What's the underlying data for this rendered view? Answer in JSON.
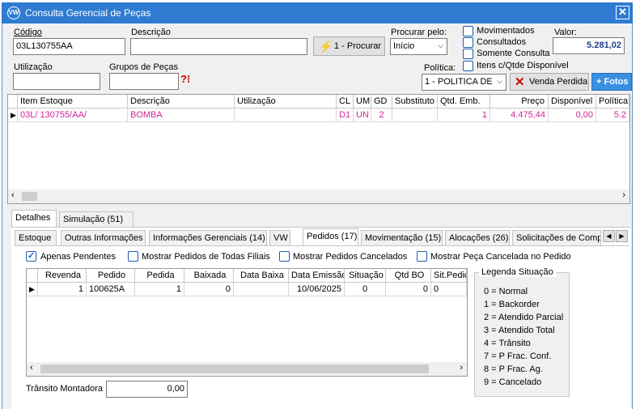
{
  "window": {
    "title": "Consulta Gerencial de Peças",
    "logo": "VW"
  },
  "form": {
    "codigo_label": "Código",
    "codigo_value": "03L130755AA",
    "descricao_label": "Descrição",
    "descricao_value": "",
    "procurar_button": "1 - Procurar",
    "procurar_pelo_label": "Procurar pelo:",
    "procurar_pelo_value": "Início",
    "utilizacao_label": "Utilização",
    "utilizacao_value": "",
    "grupos_label": "Grupos de Peças",
    "grupos_value": "",
    "filters": {
      "movimentados": "Movimentados",
      "consultados": "Consultados",
      "somente_consulta": "Somente Consulta",
      "itens_qtde": "Itens c/Qtde Disponível"
    },
    "valor_label": "Valor:",
    "valor_value": "5.281,02",
    "politica_label": "Política:",
    "politica_value": "1 - POLITICA DE",
    "venda_perdida_button": "Venda Perdida",
    "fotos_button": "+ Fotos"
  },
  "items_grid": {
    "columns": [
      "Item Estoque",
      "Descrição",
      "Utilização",
      "CL",
      "UM",
      "GD",
      "Substituto",
      "Qtd. Emb.",
      "Preço",
      "Disponível",
      "Política"
    ],
    "rows": [
      [
        "03L/ 130755/AA/",
        "BOMBA",
        "",
        "D1",
        "UN",
        "2",
        "",
        "1",
        "4.475,44",
        "0,00",
        "5.2"
      ]
    ]
  },
  "tabs_top": [
    "Detalhes",
    "Simulação (51)"
  ],
  "tabs_detail": [
    "Estoque",
    "Outras Informações",
    "Informações Gerenciais (14)",
    "VW",
    "Pedidos (17)",
    "Movimentação (15)",
    "Alocações (26)",
    "Solicitações de Compra"
  ],
  "pedidos": {
    "apenas_pendentes": "Apenas Pendentes",
    "mostrar_todas_filiais": "Mostrar Pedidos de Todas Filiais",
    "mostrar_cancelados": "Mostrar Pedidos Cancelados",
    "mostrar_peca_cancelada": "Mostrar Peça Cancelada no Pedido",
    "columns": [
      "Revenda",
      "Pedido",
      "Pedida",
      "Baixada",
      "Data Baixa",
      "Data Emissão",
      "Situação",
      "Qtd BO",
      "Sit.Pedido"
    ],
    "rows": [
      [
        "1",
        "100625A",
        "1",
        "0",
        "",
        "10/06/2025",
        "0",
        "0",
        "0"
      ]
    ],
    "transito_label": "Trânsito Montadora",
    "transito_value": "0,00"
  },
  "legenda": {
    "title": "Legenda Situação",
    "items": [
      "0 = Normal",
      "1 = Backorder",
      "2 = Atendido Parcial",
      "3 = Atendido Total",
      "4 = Trânsito",
      "7 = P Frac. Conf.",
      "8 = P Frac. Ag.",
      "9 = Cancelado"
    ]
  }
}
